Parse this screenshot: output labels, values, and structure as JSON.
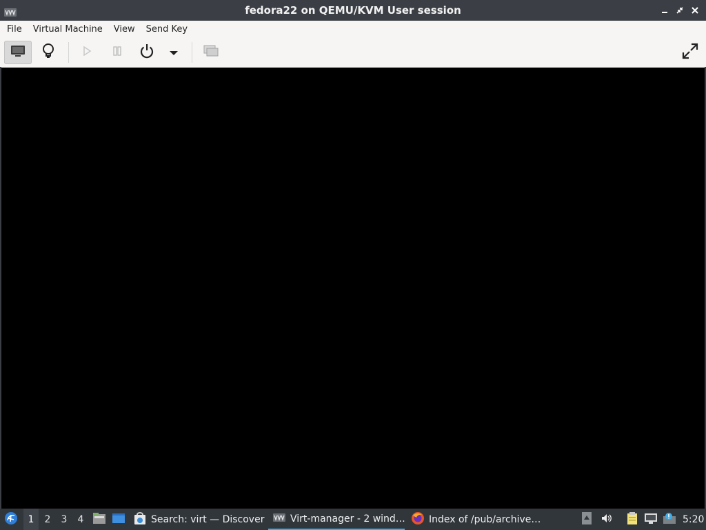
{
  "window": {
    "title": "fedora22 on QEMU/KVM User session",
    "icons": {
      "app": "virt-manager-icon",
      "minimize": "minimize-icon",
      "restore": "restore-icon",
      "close": "close-icon"
    }
  },
  "menubar": {
    "items": [
      {
        "label": "File"
      },
      {
        "label": "Virtual Machine"
      },
      {
        "label": "View"
      },
      {
        "label": "Send Key"
      }
    ]
  },
  "toolbar": {
    "buttons": [
      {
        "name": "console",
        "icon": "monitor-icon",
        "active": true
      },
      {
        "name": "details",
        "icon": "lightbulb-icon"
      },
      {
        "name": "run",
        "icon": "play-icon",
        "disabled": true
      },
      {
        "name": "pause",
        "icon": "pause-icon",
        "disabled": true
      },
      {
        "name": "shutdown",
        "icon": "power-icon"
      },
      {
        "name": "shutdown-menu",
        "icon": "dropdown-arrow-icon"
      },
      {
        "name": "snapshots",
        "icon": "snapshots-icon",
        "disabled": true
      },
      {
        "name": "fullscreen",
        "icon": "fullscreen-icon"
      }
    ]
  },
  "taskbar": {
    "desktops": [
      "1",
      "2",
      "3",
      "4"
    ],
    "active_desktop": "1",
    "tasks": [
      {
        "label": "Search: virt — Discover",
        "icon": "discover-icon"
      },
      {
        "label": "Virt-manager - 2 wind…",
        "icon": "virt-manager-icon",
        "active": true
      },
      {
        "label": "Index of /pub/archive…",
        "icon": "firefox-icon"
      }
    ],
    "clock": "5:20"
  },
  "colors": {
    "titlebar": "#3b3f45",
    "taskbar": "#31363b",
    "accent": "#3daee9",
    "display": "#000000"
  }
}
